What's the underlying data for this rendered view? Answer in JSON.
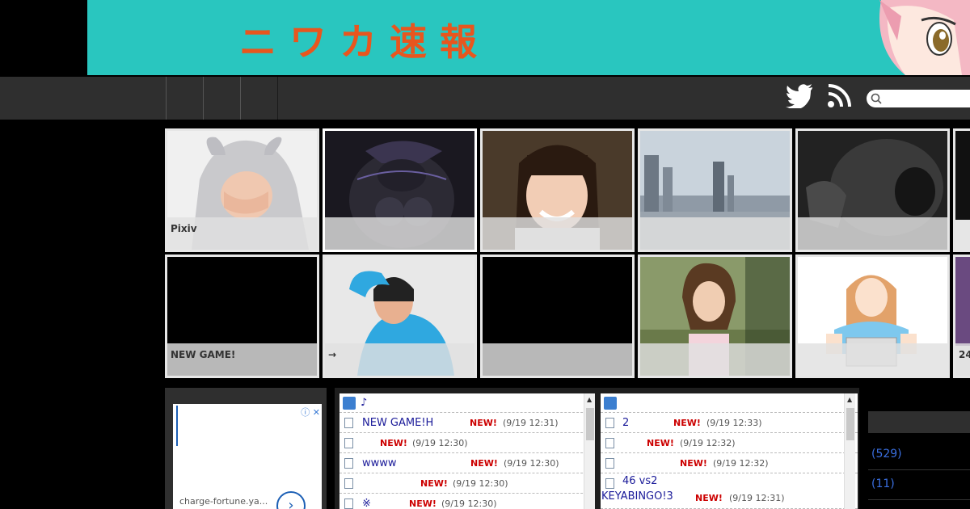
{
  "banner": {
    "title": "ニワカ速報"
  },
  "nav": {
    "twitter_icon": "twitter-icon",
    "rss_icon": "rss-icon",
    "search_placeholder": ""
  },
  "tiles_row1": [
    {
      "caption": "Pixiv"
    },
    {
      "caption": ""
    },
    {
      "caption": ""
    },
    {
      "caption": ""
    },
    {
      "caption": ""
    }
  ],
  "tiles_row2": [
    {
      "caption": "NEW GAME!"
    },
    {
      "caption": "→"
    },
    {
      "caption": ""
    },
    {
      "caption": ""
    },
    {
      "caption": ""
    },
    {
      "caption": "24"
    }
  ],
  "ad": {
    "url": "charge-fortune.ya...",
    "arrow": "›",
    "close": "ⓘ ✕"
  },
  "feed_left": {
    "site": "♪",
    "rows": [
      {
        "title": "NEW GAME!H",
        "new": "NEW!",
        "date": "(9/19 12:31)"
      },
      {
        "title": "",
        "new": "NEW!",
        "date": "(9/19 12:30)"
      },
      {
        "title": "wwww",
        "new": "NEW!",
        "date": "(9/19 12:30)"
      },
      {
        "title": "",
        "new": "NEW!",
        "date": "(9/19 12:30)"
      },
      {
        "title": "※",
        "new": "NEW!",
        "date": "(9/19 12:30)"
      }
    ]
  },
  "feed_right": {
    "site": "",
    "rows": [
      {
        "title": "2",
        "new": "NEW!",
        "date": "(9/19 12:33)"
      },
      {
        "title": "",
        "new": "NEW!",
        "date": "(9/19 12:32)"
      },
      {
        "title": "",
        "new": "NEW!",
        "date": "(9/19 12:32)"
      },
      {
        "title": "46  vs2",
        "title2": "KEYABINGO!3",
        "new": "NEW!",
        "date": "(9/19 12:31)"
      }
    ]
  },
  "rail": {
    "items": [
      "(529)",
      "(11)"
    ]
  },
  "colors": {
    "banner": "#29c6bf",
    "banner_text": "#e8561e",
    "nav": "#2f2f2f",
    "new": "#cc0000",
    "link": "#1a1a99"
  }
}
